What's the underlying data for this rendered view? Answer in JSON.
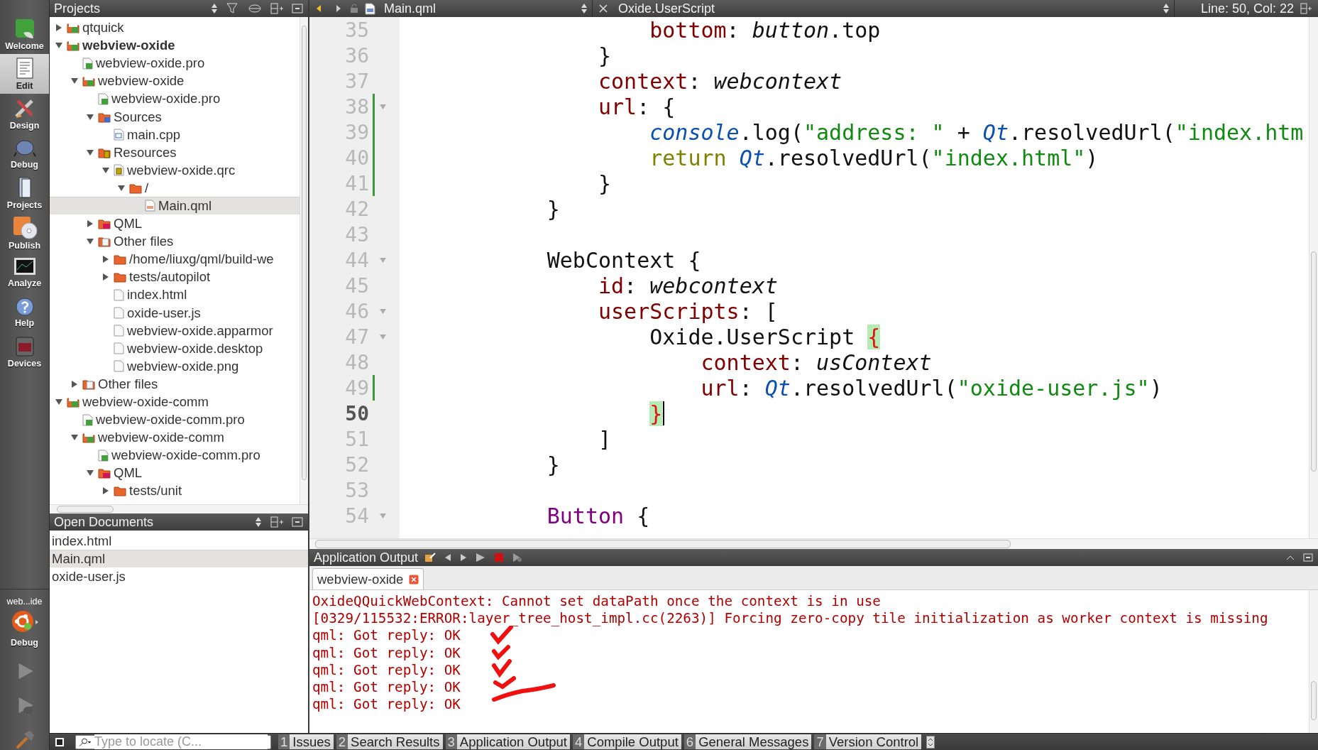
{
  "modes": [
    {
      "label": "Welcome",
      "selected": false
    },
    {
      "label": "Edit",
      "selected": true
    },
    {
      "label": "Design",
      "selected": false
    },
    {
      "label": "Debug",
      "selected": false
    },
    {
      "label": "Projects",
      "selected": false
    },
    {
      "label": "Publish",
      "selected": false
    },
    {
      "label": "Analyze",
      "selected": false
    },
    {
      "label": "Help",
      "selected": false
    },
    {
      "label": "Devices",
      "selected": false
    }
  ],
  "kit": {
    "target": "web...ide",
    "build": "Debug"
  },
  "projects": {
    "title": "Projects",
    "tree": [
      {
        "label": "qtquick",
        "kind": "project",
        "expanded": false,
        "selected": false
      },
      {
        "label": "webview-oxide",
        "kind": "project",
        "active": true,
        "expanded": true,
        "selected": false,
        "children": [
          {
            "label": "webview-oxide.pro",
            "kind": "pro",
            "selected": false
          },
          {
            "label": "webview-oxide",
            "kind": "project",
            "expanded": true,
            "selected": false,
            "children": [
              {
                "label": "webview-oxide.pro",
                "kind": "pro",
                "selected": false
              },
              {
                "label": "Sources",
                "kind": "sources",
                "expanded": true,
                "selected": false,
                "children": [
                  {
                    "label": "main.cpp",
                    "kind": "cpp",
                    "selected": false
                  }
                ]
              },
              {
                "label": "Resources",
                "kind": "resources",
                "expanded": true,
                "selected": false,
                "children": [
                  {
                    "label": "webview-oxide.qrc",
                    "kind": "qrc",
                    "expanded": true,
                    "selected": false,
                    "children": [
                      {
                        "label": "/",
                        "kind": "folder",
                        "expanded": true,
                        "selected": false,
                        "children": [
                          {
                            "label": "Main.qml",
                            "kind": "qml",
                            "selected": true
                          }
                        ]
                      }
                    ]
                  }
                ]
              },
              {
                "label": "QML",
                "kind": "qmlgroup",
                "expanded": false,
                "selected": false
              },
              {
                "label": "Other files",
                "kind": "other",
                "expanded": true,
                "selected": false,
                "children": [
                  {
                    "label": "/home/liuxg/qml/build-we",
                    "kind": "folder",
                    "expanded": false,
                    "selected": false
                  },
                  {
                    "label": "tests/autopilot",
                    "kind": "folder",
                    "expanded": false,
                    "selected": false
                  },
                  {
                    "label": "index.html",
                    "kind": "file",
                    "selected": false
                  },
                  {
                    "label": "oxide-user.js",
                    "kind": "file",
                    "selected": false
                  },
                  {
                    "label": "webview-oxide.apparmor",
                    "kind": "file",
                    "selected": false
                  },
                  {
                    "label": "webview-oxide.desktop",
                    "kind": "file",
                    "selected": false
                  },
                  {
                    "label": "webview-oxide.png",
                    "kind": "file",
                    "selected": false
                  }
                ]
              }
            ]
          },
          {
            "label": "Other files",
            "kind": "other",
            "expanded": false,
            "selected": false
          }
        ]
      },
      {
        "label": "webview-oxide-comm",
        "kind": "project",
        "expanded": true,
        "selected": false,
        "children": [
          {
            "label": "webview-oxide-comm.pro",
            "kind": "pro",
            "selected": false
          },
          {
            "label": "webview-oxide-comm",
            "kind": "project",
            "expanded": true,
            "selected": false,
            "children": [
              {
                "label": "webview-oxide-comm.pro",
                "kind": "pro",
                "selected": false
              },
              {
                "label": "QML",
                "kind": "qmlgroup",
                "expanded": true,
                "selected": false,
                "children": [
                  {
                    "label": "tests/unit",
                    "kind": "folder",
                    "expanded": false,
                    "selected": false
                  }
                ]
              }
            ]
          }
        ]
      }
    ]
  },
  "open_documents": {
    "title": "Open Documents",
    "items": [
      {
        "label": "index.html",
        "selected": false
      },
      {
        "label": "Main.qml",
        "selected": true
      },
      {
        "label": "oxide-user.js",
        "selected": false
      }
    ]
  },
  "editor": {
    "file": "Main.qml",
    "symbol": "Oxide.UserScript",
    "position": "Line: 50, Col: 22",
    "lines": [
      {
        "number": "35",
        "tokens": [
          {
            "t": "                    bottom",
            "kind": "prop"
          },
          {
            "t": ": ",
            "kind": "plain"
          },
          {
            "t": "button",
            "kind": "ident"
          },
          {
            "t": ".top",
            "kind": "plain"
          }
        ]
      },
      {
        "number": "36",
        "tokens": [
          {
            "t": "                }",
            "kind": "plain"
          }
        ]
      },
      {
        "number": "37",
        "tokens": [
          {
            "t": "                context",
            "kind": "prop"
          },
          {
            "t": ": ",
            "kind": "plain"
          },
          {
            "t": "webcontext",
            "kind": "ident"
          }
        ]
      },
      {
        "number": "38",
        "changed": true,
        "foldable": true,
        "tokens": [
          {
            "t": "                url",
            "kind": "prop"
          },
          {
            "t": ": {",
            "kind": "plain"
          }
        ]
      },
      {
        "number": "39",
        "changed": true,
        "tokens": [
          {
            "t": "                    console",
            "kind": "builtin"
          },
          {
            "t": ".log(",
            "kind": "plain"
          },
          {
            "t": "\"address: \"",
            "kind": "string"
          },
          {
            "t": " + ",
            "kind": "plain"
          },
          {
            "t": "Qt",
            "kind": "builtin"
          },
          {
            "t": ".resolvedUrl(",
            "kind": "plain"
          },
          {
            "t": "\"index.htm",
            "kind": "string"
          }
        ]
      },
      {
        "number": "40",
        "changed": true,
        "tokens": [
          {
            "t": "                    return ",
            "kind": "keyword"
          },
          {
            "t": "Qt",
            "kind": "builtin"
          },
          {
            "t": ".resolvedUrl(",
            "kind": "plain"
          },
          {
            "t": "\"index.html\"",
            "kind": "string"
          },
          {
            "t": ")",
            "kind": "plain"
          }
        ]
      },
      {
        "number": "41",
        "changed": true,
        "tokens": [
          {
            "t": "                }",
            "kind": "plain"
          }
        ]
      },
      {
        "number": "42",
        "tokens": [
          {
            "t": "            }",
            "kind": "plain"
          }
        ]
      },
      {
        "number": "43"
      },
      {
        "number": "44",
        "foldable": true,
        "tokens": [
          {
            "t": "            WebContext {",
            "kind": "plain"
          }
        ]
      },
      {
        "number": "45",
        "tokens": [
          {
            "t": "                id",
            "kind": "prop"
          },
          {
            "t": ": ",
            "kind": "plain"
          },
          {
            "t": "webcontext",
            "kind": "ident"
          }
        ]
      },
      {
        "number": "46",
        "foldable": true,
        "tokens": [
          {
            "t": "                userScripts",
            "kind": "prop"
          },
          {
            "t": ": [",
            "kind": "plain"
          }
        ]
      },
      {
        "number": "47",
        "foldable": true,
        "tokens": [
          {
            "t": "                    Oxide.UserScript ",
            "kind": "plain"
          },
          {
            "t": "{",
            "kind": "match"
          }
        ]
      },
      {
        "number": "48",
        "tokens": [
          {
            "t": "                        context",
            "kind": "prop"
          },
          {
            "t": ": ",
            "kind": "plain"
          },
          {
            "t": "usContext",
            "kind": "ident"
          }
        ]
      },
      {
        "number": "49",
        "changed": true,
        "tokens": [
          {
            "t": "                        url",
            "kind": "prop"
          },
          {
            "t": ": ",
            "kind": "plain"
          },
          {
            "t": "Qt",
            "kind": "builtin"
          },
          {
            "t": ".resolvedUrl(",
            "kind": "plain"
          },
          {
            "t": "\"oxide-user.js\"",
            "kind": "string"
          },
          {
            "t": ")",
            "kind": "plain"
          }
        ]
      },
      {
        "number": "50",
        "current": true,
        "tokens": [
          {
            "t": "                    }",
            "kind": "match"
          }
        ]
      },
      {
        "number": "51",
        "tokens": [
          {
            "t": "                ]",
            "kind": "plain"
          }
        ]
      },
      {
        "number": "52",
        "tokens": [
          {
            "t": "            }",
            "kind": "plain"
          }
        ]
      },
      {
        "number": "53"
      },
      {
        "number": "54",
        "foldable": true,
        "tokens": [
          {
            "t": "            Button",
            "kind": "type"
          },
          {
            "t": " {",
            "kind": "plain"
          }
        ]
      }
    ]
  },
  "output": {
    "title": "Application Output",
    "tabs": [
      {
        "label": "webview-oxide",
        "selected": true
      }
    ],
    "lines": [
      "OxideQQuickWebContext: Cannot set dataPath once the context is in use",
      "[0329/115532:ERROR:layer_tree_host_impl.cc(2263)] Forcing zero-copy tile initialization as worker context is missing",
      "qml: Got reply: OK",
      "qml: Got reply: OK",
      "qml: Got reply: OK",
      "qml: Got reply: OK",
      "qml: Got reply: OK"
    ]
  },
  "status_bar": {
    "locator_placeholder": "Type to locate (C...",
    "panes": [
      {
        "number": "1",
        "label": "Issues"
      },
      {
        "number": "2",
        "label": "Search Results"
      },
      {
        "number": "3",
        "label": "Application Output"
      },
      {
        "number": "4",
        "label": "Compile Output"
      },
      {
        "number": "6",
        "label": "General Messages"
      },
      {
        "number": "7",
        "label": "Version Control"
      }
    ]
  }
}
